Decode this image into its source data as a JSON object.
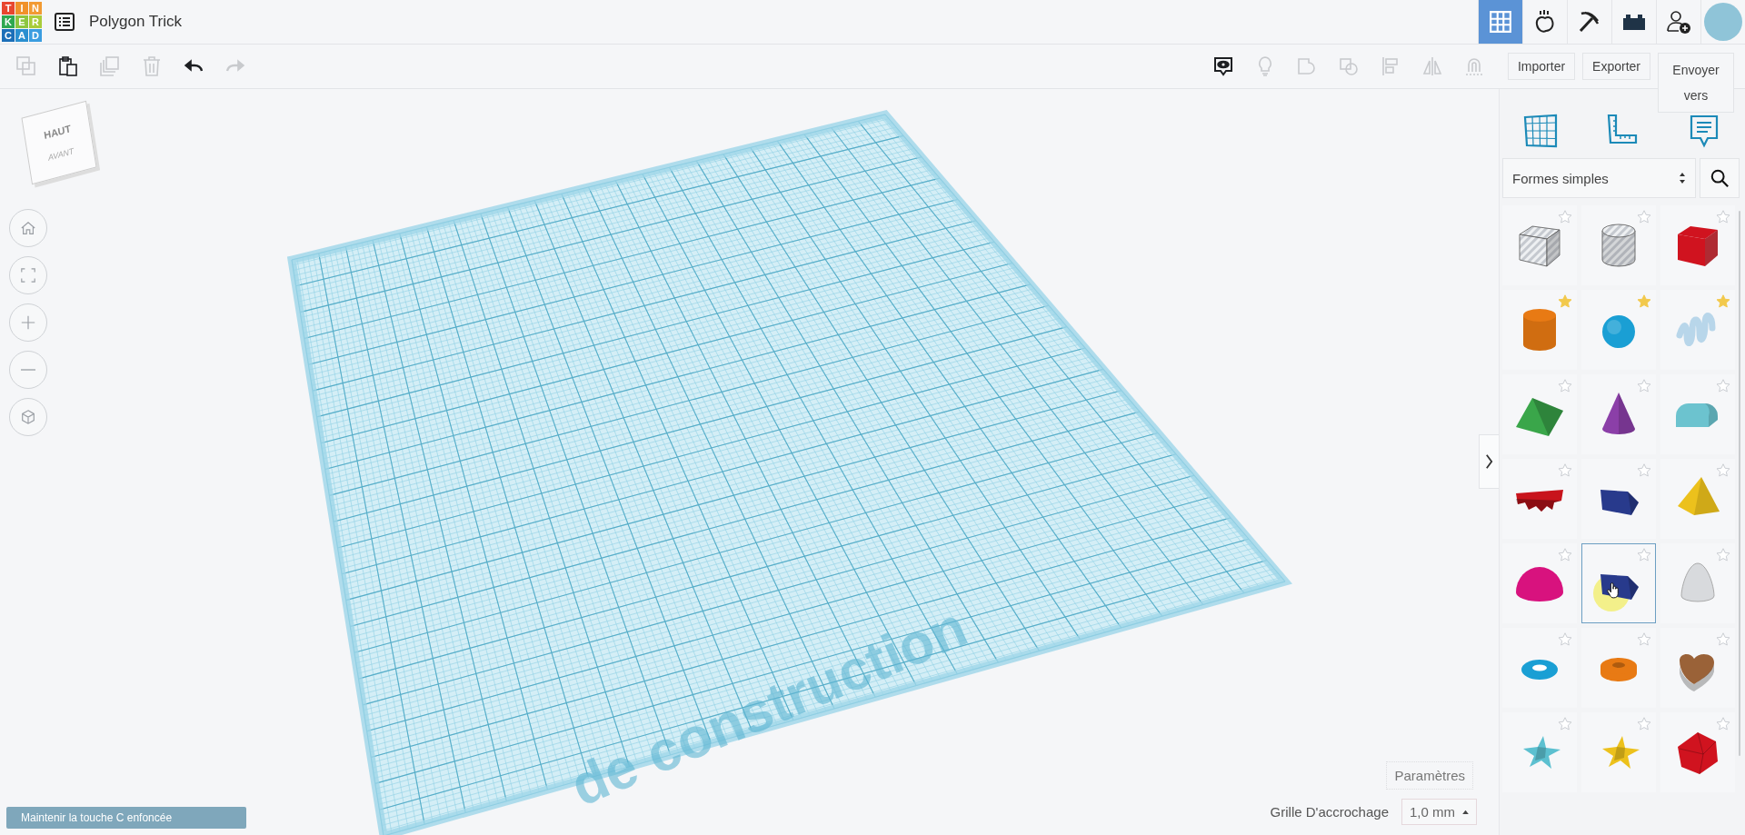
{
  "project": {
    "title": "Polygon Trick"
  },
  "logo": [
    "T",
    "I",
    "N",
    "K",
    "E",
    "R",
    "C",
    "A",
    "D"
  ],
  "nav": [
    {
      "kind": "grid",
      "selected": true
    },
    {
      "kind": "physics",
      "selected": false
    },
    {
      "kind": "pickaxe",
      "selected": false
    },
    {
      "kind": "bricks",
      "selected": false
    },
    {
      "kind": "add-user",
      "selected": false
    },
    {
      "kind": "avatar",
      "selected": false
    }
  ],
  "edit_tools": [
    {
      "kind": "copy",
      "disabled": true
    },
    {
      "kind": "paste",
      "disabled": false
    },
    {
      "kind": "duplicate",
      "disabled": true
    },
    {
      "kind": "delete",
      "disabled": true
    },
    {
      "kind": "undo",
      "disabled": false
    },
    {
      "kind": "redo",
      "disabled": true
    }
  ],
  "view_tools": [
    {
      "kind": "notes",
      "disabled": false
    },
    {
      "kind": "light",
      "disabled": true
    },
    {
      "kind": "group",
      "disabled": true
    },
    {
      "kind": "ungroup",
      "disabled": true
    },
    {
      "kind": "align",
      "disabled": true
    },
    {
      "kind": "mirror",
      "disabled": true
    },
    {
      "kind": "cruise",
      "disabled": true
    }
  ],
  "actions": [
    "Importer",
    "Exporter",
    "Envoyer vers"
  ],
  "view_cube": {
    "top": "HAUT",
    "front": "AVANT"
  },
  "view_controls": [
    {
      "kind": "home"
    },
    {
      "kind": "fit"
    },
    {
      "kind": "zoom-in"
    },
    {
      "kind": "zoom-out"
    },
    {
      "kind": "perspective"
    }
  ],
  "workplane": {
    "label": "de construction"
  },
  "panel": {
    "tools": [
      {
        "kind": "workplane"
      },
      {
        "kind": "ruler"
      },
      {
        "kind": "notes"
      }
    ],
    "library": "Formes simples",
    "shapes": [
      {
        "kind": "box",
        "color": "#c5c9cf",
        "hole": true,
        "starred": false,
        "selected": false
      },
      {
        "kind": "cylinder",
        "color": "#c5c9cf",
        "hole": true,
        "starred": false,
        "selected": false
      },
      {
        "kind": "box",
        "color": "#d0131f",
        "hole": false,
        "starred": false,
        "selected": false
      },
      {
        "kind": "cylinder",
        "color": "#e87a14",
        "hole": false,
        "starred": true,
        "selected": false
      },
      {
        "kind": "sphere",
        "color": "#1a9fd4",
        "hole": false,
        "starred": true,
        "selected": false
      },
      {
        "kind": "scribble",
        "color": "#b8d6ea",
        "hole": false,
        "starred": true,
        "selected": false
      },
      {
        "kind": "roof",
        "color": "#3aa64a",
        "hole": false,
        "starred": false,
        "selected": false
      },
      {
        "kind": "cone",
        "color": "#8b3fa8",
        "hole": false,
        "starred": false,
        "selected": false
      },
      {
        "kind": "round-roof",
        "color": "#6cc3cf",
        "hole": false,
        "starred": false,
        "selected": false
      },
      {
        "kind": "text",
        "color": "#c8141c",
        "hole": false,
        "starred": false,
        "selected": false
      },
      {
        "kind": "polygon",
        "color": "#283a8c",
        "hole": false,
        "starred": false,
        "selected": false
      },
      {
        "kind": "pyramid",
        "color": "#ecc11c",
        "hole": false,
        "starred": false,
        "selected": false
      },
      {
        "kind": "half-sphere",
        "color": "#d8127e",
        "hole": false,
        "starred": false,
        "selected": false
      },
      {
        "kind": "polygon",
        "color": "#283a8c",
        "hole": false,
        "starred": false,
        "selected": true
      },
      {
        "kind": "paraboloid",
        "color": "#d8dadd",
        "hole": false,
        "starred": false,
        "selected": false
      },
      {
        "kind": "torus",
        "color": "#1a9fd4",
        "hole": false,
        "starred": false,
        "selected": false
      },
      {
        "kind": "tube",
        "color": "#e87a14",
        "hole": false,
        "starred": false,
        "selected": false
      },
      {
        "kind": "heart",
        "color": "#9a6238",
        "hole": false,
        "starred": false,
        "selected": false
      },
      {
        "kind": "star",
        "color": "#5cc0d0",
        "hole": false,
        "starred": false,
        "selected": false
      },
      {
        "kind": "star",
        "color": "#ecc11c",
        "hole": false,
        "starred": false,
        "selected": false
      },
      {
        "kind": "icosahedron",
        "color": "#d0131f",
        "hole": false,
        "starred": false,
        "selected": false
      }
    ]
  },
  "settings_button": "Paramètres",
  "snap_grid": {
    "label": "Grille D'accrochage",
    "value": "1,0 mm"
  },
  "hint": "Maintenir la touche C enfoncée"
}
